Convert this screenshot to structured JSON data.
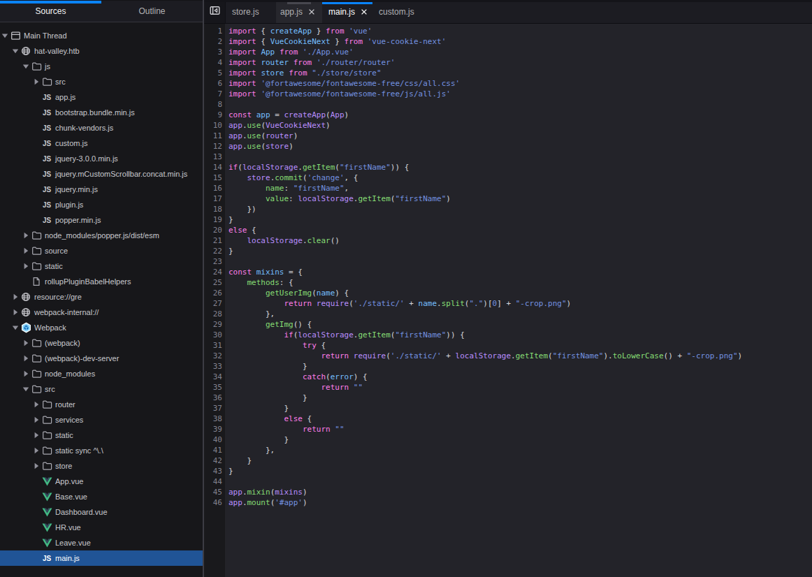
{
  "colors": {
    "accent": "#0a84ff",
    "selection_background": "#205496",
    "token_keyword": "#ff7de9",
    "token_definition": "#75bfff",
    "token_variable": "#b98eff",
    "token_property": "#86de74",
    "token_string": "#7392e0",
    "token_number": "#7392e0",
    "token_plain": "#d7d7db"
  },
  "sidebar": {
    "tabs": [
      {
        "label": "Sources",
        "active": true
      },
      {
        "label": "Outline",
        "active": false
      }
    ],
    "tree": [
      {
        "depth": 0,
        "twisty": "open",
        "icon": "window-icon",
        "label": "Main Thread"
      },
      {
        "depth": 1,
        "twisty": "open",
        "icon": "globe-icon",
        "label": "hat-valley.htb"
      },
      {
        "depth": 2,
        "twisty": "open",
        "icon": "folder-icon",
        "label": "js"
      },
      {
        "depth": 3,
        "twisty": "closed",
        "icon": "folder-icon",
        "label": "src"
      },
      {
        "depth": 3,
        "twisty": null,
        "icon": "js-icon",
        "label": "app.js"
      },
      {
        "depth": 3,
        "twisty": null,
        "icon": "js-icon",
        "label": "bootstrap.bundle.min.js"
      },
      {
        "depth": 3,
        "twisty": null,
        "icon": "js-icon",
        "label": "chunk-vendors.js"
      },
      {
        "depth": 3,
        "twisty": null,
        "icon": "js-icon",
        "label": "custom.js"
      },
      {
        "depth": 3,
        "twisty": null,
        "icon": "js-icon",
        "label": "jquery-3.0.0.min.js"
      },
      {
        "depth": 3,
        "twisty": null,
        "icon": "js-icon",
        "label": "jquery.mCustomScrollbar.concat.min.js"
      },
      {
        "depth": 3,
        "twisty": null,
        "icon": "js-icon",
        "label": "jquery.min.js"
      },
      {
        "depth": 3,
        "twisty": null,
        "icon": "js-icon",
        "label": "plugin.js"
      },
      {
        "depth": 3,
        "twisty": null,
        "icon": "js-icon",
        "label": "popper.min.js"
      },
      {
        "depth": 2,
        "twisty": "closed",
        "icon": "folder-icon",
        "label": "node_modules/popper.js/dist/esm"
      },
      {
        "depth": 2,
        "twisty": "closed",
        "icon": "folder-icon",
        "label": "source"
      },
      {
        "depth": 2,
        "twisty": "closed",
        "icon": "folder-icon",
        "label": "static"
      },
      {
        "depth": 2,
        "twisty": null,
        "icon": "file-icon",
        "label": "rollupPluginBabelHelpers"
      },
      {
        "depth": 1,
        "twisty": "closed",
        "icon": "globe-icon",
        "label": "resource://gre"
      },
      {
        "depth": 1,
        "twisty": "closed",
        "icon": "globe-icon",
        "label": "webpack-internal://"
      },
      {
        "depth": 1,
        "twisty": "open",
        "icon": "webpack-icon",
        "label": "Webpack"
      },
      {
        "depth": 2,
        "twisty": "closed",
        "icon": "folder-icon",
        "label": "(webpack)"
      },
      {
        "depth": 2,
        "twisty": "closed",
        "icon": "folder-icon",
        "label": "(webpack)-dev-server"
      },
      {
        "depth": 2,
        "twisty": "closed",
        "icon": "folder-icon",
        "label": "node_modules"
      },
      {
        "depth": 2,
        "twisty": "open",
        "icon": "folder-icon",
        "label": "src"
      },
      {
        "depth": 3,
        "twisty": "closed",
        "icon": "folder-icon",
        "label": "router"
      },
      {
        "depth": 3,
        "twisty": "closed",
        "icon": "folder-icon",
        "label": "services"
      },
      {
        "depth": 3,
        "twisty": "closed",
        "icon": "folder-icon",
        "label": "static"
      },
      {
        "depth": 3,
        "twisty": "closed",
        "icon": "folder-icon",
        "label": "static sync ^\\.\\"
      },
      {
        "depth": 3,
        "twisty": "closed",
        "icon": "folder-icon",
        "label": "store"
      },
      {
        "depth": 3,
        "twisty": null,
        "icon": "vue-icon",
        "label": "App.vue"
      },
      {
        "depth": 3,
        "twisty": null,
        "icon": "vue-icon",
        "label": "Base.vue"
      },
      {
        "depth": 3,
        "twisty": null,
        "icon": "vue-icon",
        "label": "Dashboard.vue"
      },
      {
        "depth": 3,
        "twisty": null,
        "icon": "vue-icon",
        "label": "HR.vue"
      },
      {
        "depth": 3,
        "twisty": null,
        "icon": "vue-icon",
        "label": "Leave.vue"
      },
      {
        "depth": 3,
        "twisty": null,
        "icon": "js-icon",
        "label": "main.js",
        "selected": true
      }
    ]
  },
  "editor": {
    "tabs": [
      {
        "label": "store.js",
        "close": false,
        "state": "normal",
        "width": 72
      },
      {
        "label": "app.js",
        "close": true,
        "state": "hover",
        "width": 66,
        "pad_left": 6
      },
      {
        "label": "main.js",
        "close": true,
        "state": "active",
        "width": 72
      },
      {
        "label": "custom.js",
        "close": false,
        "state": "normal",
        "width": 69
      }
    ],
    "token_legend": {
      "k": "keyword",
      "d": "definition",
      "v": "variable",
      "p": "property",
      "s": "string",
      "n": "number",
      "t": "plain"
    },
    "lines": [
      [
        [
          "k",
          "import"
        ],
        [
          "t",
          " { "
        ],
        [
          "d",
          "createApp"
        ],
        [
          "t",
          " } "
        ],
        [
          "k",
          "from"
        ],
        [
          "t",
          " "
        ],
        [
          "s",
          "'vue'"
        ]
      ],
      [
        [
          "k",
          "import"
        ],
        [
          "t",
          " { "
        ],
        [
          "d",
          "VueCookieNext"
        ],
        [
          "t",
          " } "
        ],
        [
          "k",
          "from"
        ],
        [
          "t",
          " "
        ],
        [
          "s",
          "'vue-cookie-next'"
        ]
      ],
      [
        [
          "k",
          "import"
        ],
        [
          "t",
          " "
        ],
        [
          "d",
          "App"
        ],
        [
          "t",
          " "
        ],
        [
          "k",
          "from"
        ],
        [
          "t",
          " "
        ],
        [
          "s",
          "'./App.vue'"
        ]
      ],
      [
        [
          "k",
          "import"
        ],
        [
          "t",
          " "
        ],
        [
          "d",
          "router"
        ],
        [
          "t",
          " "
        ],
        [
          "k",
          "from"
        ],
        [
          "t",
          " "
        ],
        [
          "s",
          "'./router/router'"
        ]
      ],
      [
        [
          "k",
          "import"
        ],
        [
          "t",
          " "
        ],
        [
          "d",
          "store"
        ],
        [
          "t",
          " "
        ],
        [
          "k",
          "from"
        ],
        [
          "t",
          " "
        ],
        [
          "s",
          "\"./store/store\""
        ]
      ],
      [
        [
          "k",
          "import"
        ],
        [
          "t",
          " "
        ],
        [
          "s",
          "'@fortawesome/fontawesome-free/css/all.css'"
        ]
      ],
      [
        [
          "k",
          "import"
        ],
        [
          "t",
          " "
        ],
        [
          "s",
          "'@fortawesome/fontawesome-free/js/all.js'"
        ]
      ],
      [],
      [
        [
          "k",
          "const"
        ],
        [
          "t",
          " "
        ],
        [
          "d",
          "app"
        ],
        [
          "t",
          " = "
        ],
        [
          "v",
          "createApp"
        ],
        [
          "t",
          "("
        ],
        [
          "v",
          "App"
        ],
        [
          "t",
          ")"
        ]
      ],
      [
        [
          "v",
          "app"
        ],
        [
          "t",
          "."
        ],
        [
          "p",
          "use"
        ],
        [
          "t",
          "("
        ],
        [
          "v",
          "VueCookieNext"
        ],
        [
          "t",
          ")"
        ]
      ],
      [
        [
          "v",
          "app"
        ],
        [
          "t",
          "."
        ],
        [
          "p",
          "use"
        ],
        [
          "t",
          "("
        ],
        [
          "v",
          "router"
        ],
        [
          "t",
          ")"
        ]
      ],
      [
        [
          "v",
          "app"
        ],
        [
          "t",
          "."
        ],
        [
          "p",
          "use"
        ],
        [
          "t",
          "("
        ],
        [
          "v",
          "store"
        ],
        [
          "t",
          ")"
        ]
      ],
      [],
      [
        [
          "k",
          "if"
        ],
        [
          "t",
          "("
        ],
        [
          "v",
          "localStorage"
        ],
        [
          "t",
          "."
        ],
        [
          "p",
          "getItem"
        ],
        [
          "t",
          "("
        ],
        [
          "s",
          "\"firstName\""
        ],
        [
          "t",
          ")) {"
        ]
      ],
      [
        [
          "t",
          "    "
        ],
        [
          "v",
          "store"
        ],
        [
          "t",
          "."
        ],
        [
          "p",
          "commit"
        ],
        [
          "t",
          "("
        ],
        [
          "s",
          "'change'"
        ],
        [
          "t",
          ", {"
        ]
      ],
      [
        [
          "t",
          "        "
        ],
        [
          "p",
          "name"
        ],
        [
          "t",
          ": "
        ],
        [
          "s",
          "\"firstName\""
        ],
        [
          "t",
          ","
        ]
      ],
      [
        [
          "t",
          "        "
        ],
        [
          "p",
          "value"
        ],
        [
          "t",
          ": "
        ],
        [
          "v",
          "localStorage"
        ],
        [
          "t",
          "."
        ],
        [
          "p",
          "getItem"
        ],
        [
          "t",
          "("
        ],
        [
          "s",
          "\"firstName\""
        ],
        [
          "t",
          ")"
        ]
      ],
      [
        [
          "t",
          "    })"
        ]
      ],
      [
        [
          "t",
          "}"
        ]
      ],
      [
        [
          "k",
          "else"
        ],
        [
          "t",
          " {"
        ]
      ],
      [
        [
          "t",
          "    "
        ],
        [
          "v",
          "localStorage"
        ],
        [
          "t",
          "."
        ],
        [
          "p",
          "clear"
        ],
        [
          "t",
          "()"
        ]
      ],
      [
        [
          "t",
          "}"
        ]
      ],
      [],
      [
        [
          "k",
          "const"
        ],
        [
          "t",
          " "
        ],
        [
          "d",
          "mixins"
        ],
        [
          "t",
          " = {"
        ]
      ],
      [
        [
          "t",
          "    "
        ],
        [
          "p",
          "methods"
        ],
        [
          "t",
          ": {"
        ]
      ],
      [
        [
          "t",
          "        "
        ],
        [
          "p",
          "getUserImg"
        ],
        [
          "t",
          "("
        ],
        [
          "d",
          "name"
        ],
        [
          "t",
          ") {"
        ]
      ],
      [
        [
          "t",
          "            "
        ],
        [
          "k",
          "return"
        ],
        [
          "t",
          " "
        ],
        [
          "v",
          "require"
        ],
        [
          "t",
          "("
        ],
        [
          "s",
          "'./static/'"
        ],
        [
          "t",
          " + "
        ],
        [
          "d",
          "name"
        ],
        [
          "t",
          "."
        ],
        [
          "p",
          "split"
        ],
        [
          "t",
          "("
        ],
        [
          "s",
          "\".\""
        ],
        [
          "t",
          ")["
        ],
        [
          "n",
          "0"
        ],
        [
          "t",
          "] + "
        ],
        [
          "s",
          "\"-crop.png\""
        ],
        [
          "t",
          ")"
        ]
      ],
      [
        [
          "t",
          "        },"
        ]
      ],
      [
        [
          "t",
          "        "
        ],
        [
          "p",
          "getImg"
        ],
        [
          "t",
          "() {"
        ]
      ],
      [
        [
          "t",
          "            "
        ],
        [
          "k",
          "if"
        ],
        [
          "t",
          "("
        ],
        [
          "v",
          "localStorage"
        ],
        [
          "t",
          "."
        ],
        [
          "p",
          "getItem"
        ],
        [
          "t",
          "("
        ],
        [
          "s",
          "\"firstName\""
        ],
        [
          "t",
          ")) {"
        ]
      ],
      [
        [
          "t",
          "                "
        ],
        [
          "k",
          "try"
        ],
        [
          "t",
          " {"
        ]
      ],
      [
        [
          "t",
          "                    "
        ],
        [
          "k",
          "return"
        ],
        [
          "t",
          " "
        ],
        [
          "v",
          "require"
        ],
        [
          "t",
          "("
        ],
        [
          "s",
          "'./static/'"
        ],
        [
          "t",
          " + "
        ],
        [
          "v",
          "localStorage"
        ],
        [
          "t",
          "."
        ],
        [
          "p",
          "getItem"
        ],
        [
          "t",
          "("
        ],
        [
          "s",
          "\"firstName\""
        ],
        [
          "t",
          ")."
        ],
        [
          "p",
          "toLowerCase"
        ],
        [
          "t",
          "() + "
        ],
        [
          "s",
          "\"-crop.png\""
        ],
        [
          "t",
          ")"
        ]
      ],
      [
        [
          "t",
          "                }"
        ]
      ],
      [
        [
          "t",
          "                "
        ],
        [
          "k",
          "catch"
        ],
        [
          "t",
          "("
        ],
        [
          "d",
          "error"
        ],
        [
          "t",
          ") {"
        ]
      ],
      [
        [
          "t",
          "                    "
        ],
        [
          "k",
          "return"
        ],
        [
          "t",
          " "
        ],
        [
          "s",
          "\"\""
        ]
      ],
      [
        [
          "t",
          "                }"
        ]
      ],
      [
        [
          "t",
          "            }"
        ]
      ],
      [
        [
          "t",
          "            "
        ],
        [
          "k",
          "else"
        ],
        [
          "t",
          " {"
        ]
      ],
      [
        [
          "t",
          "                "
        ],
        [
          "k",
          "return"
        ],
        [
          "t",
          " "
        ],
        [
          "s",
          "\"\""
        ]
      ],
      [
        [
          "t",
          "            }"
        ]
      ],
      [
        [
          "t",
          "        },"
        ]
      ],
      [
        [
          "t",
          "    }"
        ]
      ],
      [
        [
          "t",
          "}"
        ]
      ],
      [],
      [
        [
          "v",
          "app"
        ],
        [
          "t",
          "."
        ],
        [
          "p",
          "mixin"
        ],
        [
          "t",
          "("
        ],
        [
          "v",
          "mixins"
        ],
        [
          "t",
          ")"
        ]
      ],
      [
        [
          "v",
          "app"
        ],
        [
          "t",
          "."
        ],
        [
          "p",
          "mount"
        ],
        [
          "t",
          "("
        ],
        [
          "s",
          "'#app'"
        ],
        [
          "t",
          ")"
        ]
      ]
    ]
  }
}
